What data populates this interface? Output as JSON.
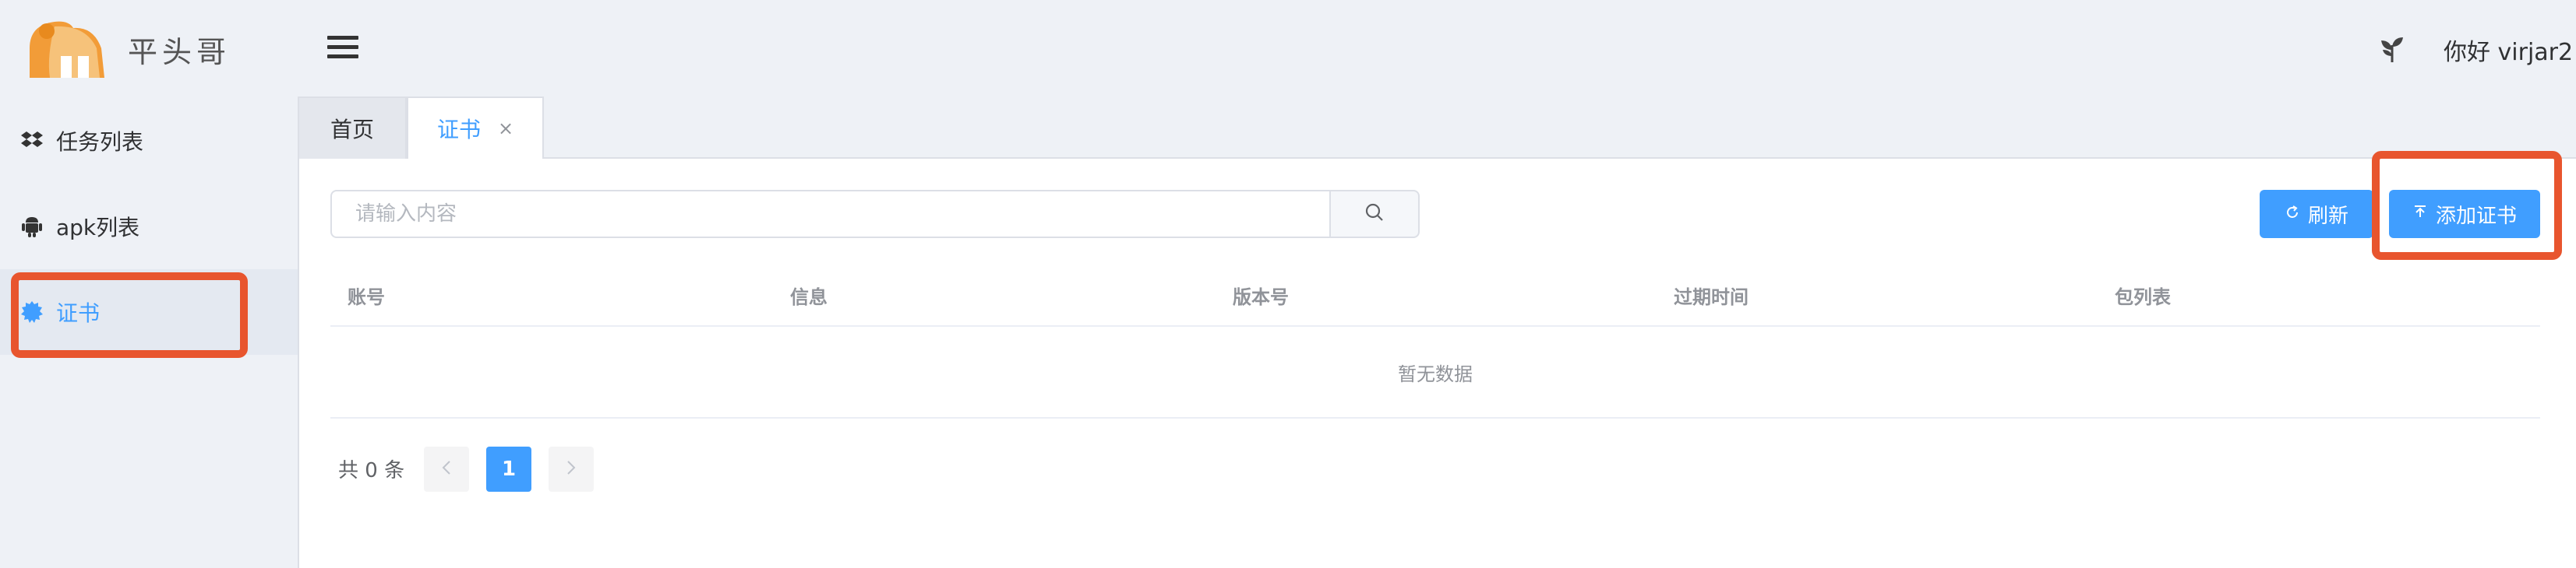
{
  "brand": {
    "name": "平头哥"
  },
  "sidebar": {
    "items": [
      {
        "label": "任务列表",
        "icon": "dropbox-icon"
      },
      {
        "label": "apk列表",
        "icon": "android-icon"
      },
      {
        "label": "证书",
        "icon": "badge-icon",
        "active": true
      }
    ]
  },
  "header": {
    "greeting": "你好 virjar2"
  },
  "tabs": [
    {
      "label": "首页"
    },
    {
      "label": "证书",
      "active": true,
      "close": "×"
    }
  ],
  "toolbar": {
    "search_placeholder": "请输入内容",
    "refresh_label": "刷新",
    "add_label": "添加证书"
  },
  "table": {
    "columns": [
      "账号",
      "信息",
      "版本号",
      "过期时间",
      "包列表"
    ],
    "empty_text": "暂无数据"
  },
  "pagination": {
    "total": "共 0 条",
    "current_page": "1"
  },
  "colors": {
    "accent": "#409eff",
    "highlight": "#e8552e",
    "sidebar_bg": "#eef1f6"
  }
}
